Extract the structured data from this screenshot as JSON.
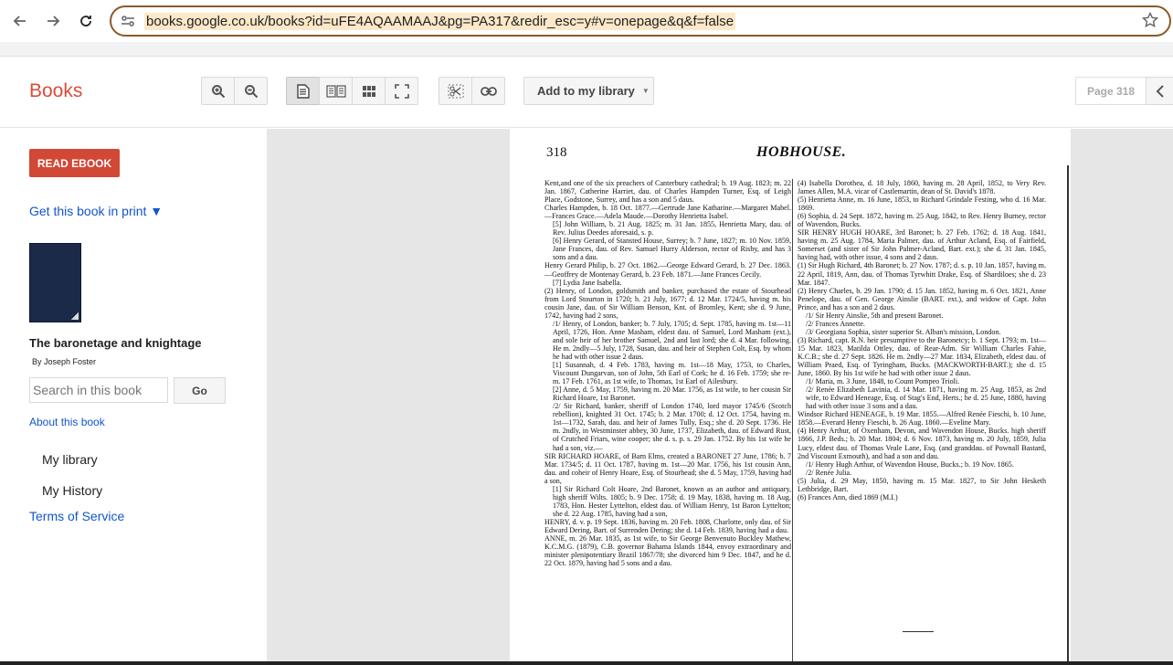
{
  "browser": {
    "url": "books.google.co.uk/books?id=uFE4AQAAMAAJ&pg=PA317&redir_esc=y#v=onepage&q&f=false",
    "icons": {
      "back": "arrow-left",
      "forward": "arrow-right",
      "reload": "reload",
      "site_info": "tune",
      "bookmark": "star"
    }
  },
  "header": {
    "brand": "Books",
    "add_to_library": "Add to my library",
    "page_indicator": "Page 318"
  },
  "sidebar": {
    "read_ebook": "READ EBOOK",
    "get_in_print": "Get this book in print ▼",
    "book_title": "The baronetage and knightage",
    "author": "By Joseph Foster",
    "search_placeholder": "Search in this book",
    "go": "Go",
    "about": "About this book",
    "my_library": "My library",
    "my_history": "My History",
    "terms": "Terms of Service"
  },
  "page": {
    "number": "318",
    "running_head": "HOBHOUSE.",
    "left_column": [
      "Kent,and one of the six preachers of Canterbury cathedral; b. 19 Aug. 1823; m. 22 Jan. 1867, Catherine Harriet, dau. of Charles Hampden Turner, Esq. of Leigh Place, Godstone, Surrey, and has a son and 5 daus.",
      "Charles Hampden, b. 18 Oct. 1877.—Gertrude Jane Katharine.—Margaret Mabel.—Frances Grace.—Adela Maude.—Dorothy Henrietta Isabel.",
      "[5] John William, b. 21 Aug. 1825; m. 31 Jan. 1855, Henrietta Mary, dau. of Rev. Julius Deedes aforesaid, s. p.",
      "[6] Henry Gerard, of Stansted House, Surrey; b. 7 June, 1827; m. 10 Nov. 1859, Jane Frances, dau. of Rev. Samuel Hurry Alderson, rector of Risby, and has 3 sons and a dau.",
      "Henry Gerard Philip, b. 27 Oct. 1862.—George Edward Gerard, b. 27 Dec. 1863.—Geoffrey de Montenay Gerard, b. 23 Feb. 1871.—Jane Frances Cecily.",
      "[7] Lydia Jane Isabella.",
      "(2) Henry, of London, goldsmith and banker, purchased the estate of Stourhead from Lord Stourton in 1720; b. 21 July, 1677; d. 12 Mar. 1724/5, having m. his cousin Jane, dau. of Sir William Benson, Knt. of Bromley, Kent; she d. 9 June, 1742, having had 2 sons,",
      "/1/ Henry, of London, banker; b. 7 July, 1705; d. Sept. 1785, having m. 1st—11 April, 1726, Hon. Anne Masham, eldest dau. of Samuel, Lord Masham (ext.), and sole heir of her brother Samuel, 2nd and last lord; she d. 4 Mar. following. He m. 2ndly—5 July, 1728, Susan, dau. and heir of Stephen Colt, Esq. by whom he had with other issue 2 daus.",
      "[1] Susannah, d. 4 Feb. 1783, having m. 1st—18 May, 1753, to Charles, Viscount Dungarvan, son of John, 5th Earl of Cork; he d. 16 Feb. 1759; she re-m. 17 Feb. 1761, as 1st wife, to Thomas, 1st Earl of Ailesbury.",
      "[2] Anne, d. 5 May, 1759, having m. 20 Mar. 1756, as 1st wife, to her cousin Sir Richard Hoare, 1st Baronet.",
      "/2/ Sir Richard, banker, sheriff of London 1740, lord mayor 1745/6 (Scotch rebellion), knighted 31 Oct. 1745; b. 2 Mar. 1700; d. 12 Oct. 1754, having m. 1st—1732, Sarah, dau. and heir of James Tully, Esq.; she d. 20 Sept. 1736. He m. 2ndly, in Westminster abbey, 30 June, 1737, Elizabeth, dau. of Edward Rust, of Crutched Friars, wine cooper; she d. s. p. s. 29 Jan. 1752. By his 1st wife he had a son, viz.—",
      "SIR RICHARD HOARE, of Barn Elms, created a BARONET 27 June, 1786; b. 7 Mar. 1734/5; d. 11 Oct. 1787, having m. 1st—20 Mar. 1756, his 1st cousin Ann, dau. and coheir of Henry Hoare, Esq. of Stourhead; she d. 5 May, 1759, having had a son,",
      "[1] Sir Richard Colt Hoare, 2nd Baronet, known as an author and antiquary, high sheriff Wilts. 1805; b. 9 Dec. 1758; d. 19 May, 1838, having m. 18 Aug. 1783, Hon. Hester Lyttelton, eldest dau. of William Henry, 1st Baron Lyttelton; she d. 22 Aug. 1785, having had a son,",
      "HENRY, d. v. p. 19 Sept. 1836, having m. 20 Feb. 1808, Charlotte, only dau. of Sir Edward Dering, Bart. of Surrenden Dering; she d. 14 Feb. 1839, having had a dau.",
      "ANNE, m. 26 Mar. 1835, as 1st wife, to Sir George Benvenuto Buckley Mathew, K.C.M.G. (1879), C.B. governor Bahama Islands 1844, envoy extraordinary and minister plenipotentiary Brazil 1867/78; she divorced him 9 Dec. 1847, and he d. 22 Oct. 1879, having had 5 sons and a dau."
    ],
    "right_column": [
      "(4) Isabella Dorothea, d. 18 July, 1860, having m. 28 April, 1852, to Very Rev. James Allen, M.A. vicar of Castlemartin, dean of St. David's 1878.",
      "(5) Henrietta Anne, m. 16 June, 1853, to Richard Grindale Festing, who d. 16 Mar. 1869.",
      "(6) Sophia, d. 24 Sept. 1872, having m. 25 Aug. 1842, to Rev. Henry Burney, rector of Wavendon, Bucks.",
      "SIR HENRY HUGH HOARE, 3rd Baronet; b. 27 Feb. 1762; d. 18 Aug. 1841, having m. 25 Aug. 1784, Maria Palmer, dau. of Arthur Acland, Esq. of Fairfield, Somerset (and sister of Sir John Palmer-Acland, Bart. ext.); she d. 31 Jan. 1845, having had, with other issue, 4 sons and 2 daus.",
      "(1) Sir Hugh Richard, 4th Baronet; b. 27 Nov. 1787; d. s. p. 10 Jan. 1857, having m. 22 April, 1819, Ann, dau. of Thomas Tyrwhitt Drake, Esq. of Shardiloes; she d. 23 Mar. 1847.",
      "(2) Henry Charles, b. 29 Jan. 1790; d. 15 Jan. 1852, having m. 6 Oct. 1821, Anne Penelope, dau. of Gen. George Ainslie (BART. ext.), and widow of Capt. John Prince, and has a son and 2 daus.",
      "/1/ Sir Henry Ainslie, 5th and present Baronet.",
      "/2/ Frances Annette.",
      "/3/ Georgiana Sophia, sister superior St. Alban's mission, London.",
      "(3) Richard, capt. R.N. heir presumptive to the Baronetcy; b. 1 Sept. 1793; m. 1st—15 Mar. 1823, Matilda Ottley, dau. of Rear-Adm. Sir William Charles Fahie, K.C.B.; she d. 27 Sept. 1826. He m. 2ndly—27 Mar. 1834, Elizabeth, eldest dau. of William Praed, Esq. of Tyringham, Bucks. (MACKWORTH-BART.); she d. 15 June, 1860. By his 1st wife he had with other issue 2 daus.",
      "/1/ Maria, m. 3 June, 1848, to Count Pompeo Trioli.",
      "/2/ Renée Elizabeth Lavinia, d. 14 Mar. 1871, having m. 25 Aug. 1853, as 2nd wife, to Edward Heneage, Esq. of Stag's End, Herts.; he d. 25 June, 1880, having had with other issue 3 sons and a dau.",
      "Windsor Richard HENEAGE, b. 19 Mar. 1855.—Alfred Renée Fieschi, b. 10 June, 1858.—Everard Henry Fieschi, b. 26 Aug. 1860.—Eveline Mary.",
      "(4) Henry Arthur, of Oxenham, Devon, and Wavendon House, Bucks. high sheriff 1866, J.P. Beds.; b. 20 Mar. 1804; d. 6 Nov. 1873, having m. 20 July, 1859, Julia Lucy, eldest dau. of Thomas Veale Lane, Esq. (and granddau. of Pownall Bastard, 2nd Viscount Exmouth), and had a son and dau.",
      "/1/ Henry Hugh Arthur, of Wavendon House, Bucks.; b. 19 Nov. 1865.",
      "/2/ Renée Julia.",
      "(5) Julia, d. 29 May, 1850, having m. 15 Mar. 1827, to Sir John Hesketh Lethbridge, Bart.",
      "(6) Frances Ann, died 1869 (M.I.)"
    ]
  }
}
